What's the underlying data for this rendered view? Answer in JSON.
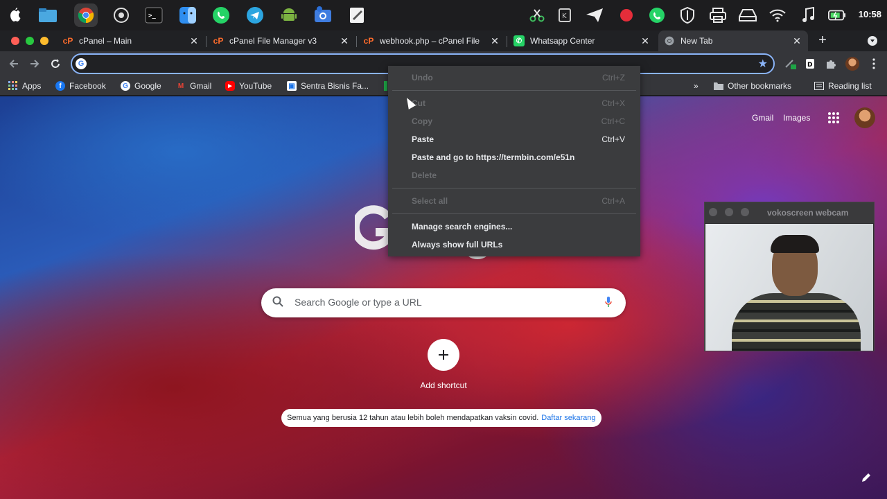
{
  "colors": {
    "accent": "#8ab4f8",
    "tab_bg": "#202124",
    "toolbar_bg": "#35363a",
    "menu_bg": "#3b3c3e",
    "link": "#1a73e8"
  },
  "topbar": {
    "left_icons": [
      "apple-logo-icon",
      "files-icon",
      "chrome-icon",
      "screenshot-icon",
      "terminal-icon",
      "finder-icon",
      "whatsapp-icon",
      "telegram-icon",
      "android-studio-icon",
      "camera-icon",
      "text-editor-icon"
    ],
    "right_icons": [
      "scissors-icon",
      "keyboard-icon",
      "send-icon",
      "record-icon",
      "whatsapp-icon",
      "shield-icon",
      "printer-icon",
      "drive-icon",
      "wifi-icon",
      "music-icon",
      "battery-icon"
    ],
    "clock": "10:58"
  },
  "tabs": [
    {
      "title": "cPanel – Main",
      "icon": "cpanel-icon",
      "active": false
    },
    {
      "title": "cPanel File Manager v3",
      "icon": "cpanel-icon",
      "active": false
    },
    {
      "title": "webhook.php – cPanel File",
      "icon": "cpanel-icon",
      "active": false
    },
    {
      "title": "Whatsapp Center",
      "icon": "whatsapp-icon",
      "active": false
    },
    {
      "title": "New Tab",
      "icon": "chrome-icon",
      "active": true
    }
  ],
  "new_tab_symbol": "+",
  "omnibox": {
    "value": "",
    "placeholder": ""
  },
  "bookmarks": {
    "items": [
      {
        "label": "Apps",
        "icon": "apps-grid-icon"
      },
      {
        "label": "Facebook",
        "icon": "facebook-icon"
      },
      {
        "label": "Google",
        "icon": "google-icon"
      },
      {
        "label": "Gmail",
        "icon": "gmail-icon"
      },
      {
        "label": "YouTube",
        "icon": "youtube-icon"
      },
      {
        "label": "Sentra Bisnis Fa...",
        "icon": "sentra-icon"
      }
    ],
    "more": "»",
    "other": "Other bookmarks",
    "reading": "Reading list"
  },
  "ntp": {
    "gmail": "Gmail",
    "images": "Images",
    "search_placeholder": "Search Google or type a URL",
    "add_shortcut": "Add shortcut",
    "promo_text": "Semua yang berusia 12 tahun atau lebih boleh mendapatkan vaksin covid.",
    "promo_link": "Daftar sekarang"
  },
  "context_menu": {
    "undo": {
      "label": "Undo",
      "shortcut": "Ctrl+Z"
    },
    "cut": {
      "label": "Cut",
      "shortcut": "Ctrl+X"
    },
    "copy": {
      "label": "Copy",
      "shortcut": "Ctrl+C"
    },
    "paste": {
      "label": "Paste",
      "shortcut": "Ctrl+V"
    },
    "paste_go": {
      "label": "Paste and go to https://termbin.com/e51n"
    },
    "delete": {
      "label": "Delete"
    },
    "select_all": {
      "label": "Select all",
      "shortcut": "Ctrl+A"
    },
    "manage": {
      "label": "Manage search engines..."
    },
    "full_urls": {
      "label": "Always show full URLs"
    }
  },
  "webcam": {
    "title": "vokoscreen webcam"
  }
}
